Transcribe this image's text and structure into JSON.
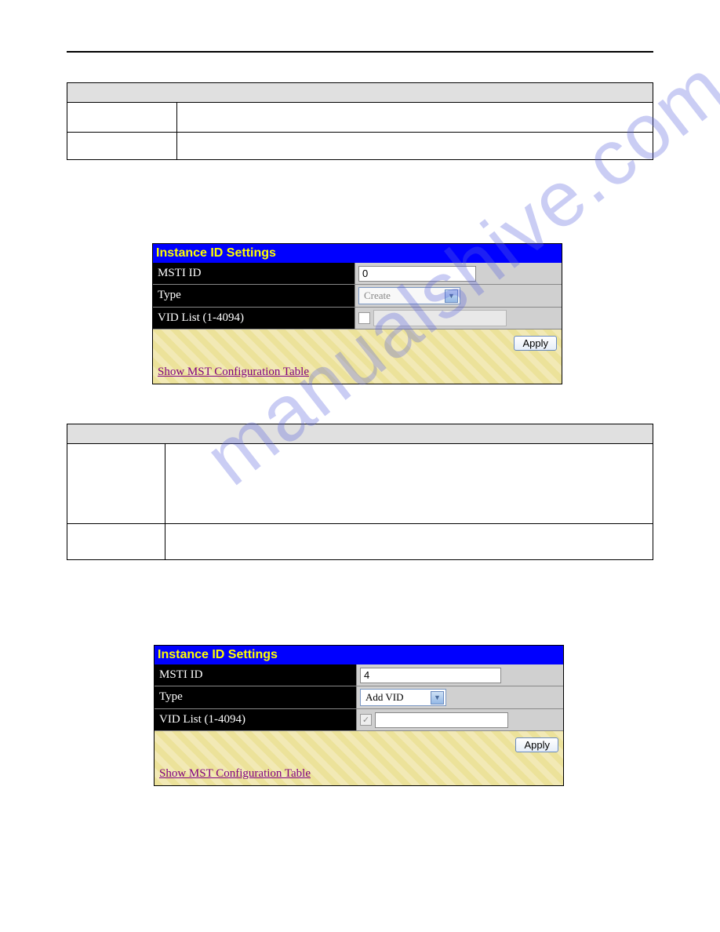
{
  "watermark": "manualshive.com",
  "panel1": {
    "title": "Instance ID Settings",
    "msti_label": "MSTI ID",
    "msti_value": "0",
    "type_label": "Type",
    "type_value": "Create",
    "vid_label": "VID List (1-4094)",
    "apply": "Apply",
    "link": "Show MST Configuration Table"
  },
  "panel2": {
    "title": "Instance ID Settings",
    "msti_label": "MSTI ID",
    "msti_value": "4",
    "type_label": "Type",
    "type_value": "Add VID",
    "vid_label": "VID List (1-4094)",
    "vid_checked": "✓",
    "apply": "Apply",
    "link": "Show MST Configuration Table"
  }
}
